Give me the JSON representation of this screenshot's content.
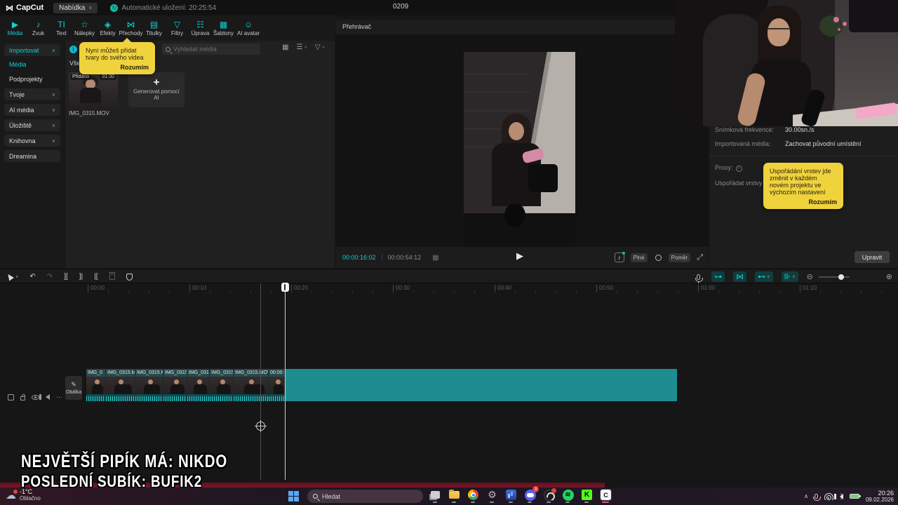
{
  "colors": {
    "accent": "#12d0d0",
    "tooltip_yellow": "#f0d23c",
    "clip_teal": "#1e8d92",
    "kick_green": "#53fc18",
    "spotify_green": "#1ed760",
    "discord_purple": "#5865f2"
  },
  "app": {
    "brand": "CapCut",
    "menu_label": "Nabídka",
    "autosave": "Automatické uložení: 20:25:54",
    "project_title": "0209"
  },
  "tabs": [
    {
      "label": "Média",
      "icon": "▶",
      "active": true
    },
    {
      "label": "Zvuk",
      "icon": "♪"
    },
    {
      "label": "Text",
      "icon": "TI"
    },
    {
      "label": "Nálepky",
      "icon": "☆"
    },
    {
      "label": "Efekty",
      "icon": "◈"
    },
    {
      "label": "Přechody",
      "icon": "⋈"
    },
    {
      "label": "Titulky",
      "icon": "▤"
    },
    {
      "label": "Filtry",
      "icon": "▽"
    },
    {
      "label": "Úprava",
      "icon": "☷"
    },
    {
      "label": "Šablony",
      "icon": "▦"
    },
    {
      "label": "AI avatar",
      "icon": "☺"
    }
  ],
  "sidebar": {
    "items": [
      {
        "label": "Importovat",
        "chev": "∧"
      },
      {
        "label": "Média"
      },
      {
        "label": "Podprojekty"
      },
      {
        "label": "Tvoje",
        "chev": "∨"
      },
      {
        "label": "AI média",
        "chev": "∨"
      },
      {
        "label": "Úložiště",
        "chev": "∨"
      },
      {
        "label": "Knihovna",
        "chev": "∨"
      },
      {
        "label": "Dreamina"
      }
    ]
  },
  "media": {
    "search_placeholder": "Vyhledat média",
    "all_label": "Vše",
    "added_badge": "Přidáno",
    "duration": "01:30",
    "filename": "IMG_0315.MOV",
    "ai_label": "Generovat pomocí AI",
    "tooltip_text": "Nyní můžeš přidat tvary do svého videa",
    "tooltip_btn": "Rozumím"
  },
  "player": {
    "panel_label": "Přehrávač",
    "current": "00:00:16:02",
    "total": "00:00:54:12",
    "quality_btn": "Plné",
    "ratio_btn": "Poměr"
  },
  "inspector": {
    "fps_label": "Snímková frekvence:",
    "fps_value": "30.00sn./s",
    "import_label": "Importovaná média:",
    "import_value": "Zachovat původní umístění",
    "proxy_label": "Proxy:",
    "layers_label": "Uspořádat vrstvy",
    "tooltip_text": "Uspořádání vrstev jde změnit v každém novém projektu ve výchozím nastavení",
    "tooltip_btn": "Rozumím",
    "edit_btn": "Upravit"
  },
  "timeline": {
    "cover_label": "Obálka",
    "ruler": [
      "00:00",
      "00:10",
      "00:20",
      "00:30",
      "00:40",
      "00:50",
      "01:00",
      "01:10"
    ],
    "clips": [
      "IMG_0",
      "IMG_0315.M",
      "IMG_0315.M",
      "IMG_0315",
      "IMG_031",
      "IMG_0315",
      "IMG_0315.MOV",
      "00:00:"
    ]
  },
  "overlay": {
    "line1": "NEJVĚTŠÍ PIPÍK MÁ: NIKDO",
    "line2": "POSLEDNÍ SUBÍK: BUFIK2"
  },
  "taskbar": {
    "temp": "-1°C",
    "condition": "Oblačno",
    "search_label": "Hledat",
    "discord_badge": "3",
    "time": "20:26",
    "date": "09.02.2026",
    "spotify_glyph": "≋",
    "kick_glyph": "K",
    "capcut_glyph": "C"
  },
  "icons": {
    "logo": "⋈",
    "chev_down": "∨",
    "chev_up": "∧",
    "autosave_arrow": "↻",
    "grid_view": "▦",
    "sort_view": "☰",
    "filter_view": "▽",
    "play": "▶",
    "note": "♪",
    "grid_small": "▦",
    "fullscreen": "⤢",
    "undo": "↶",
    "redo": "↷",
    "split": "][",
    "trim_left": "]|",
    "trim_right": "|[",
    "ellipsis": "⋯",
    "zoom_out": "⊖",
    "zoom_in": "⊕",
    "gear": "⚙",
    "cloud": "☁",
    "pencil": "✎",
    "info_i": "i",
    "magnet1": "⊶",
    "magnet2": "⋈",
    "link": "⊷",
    "snap": "⊪"
  }
}
